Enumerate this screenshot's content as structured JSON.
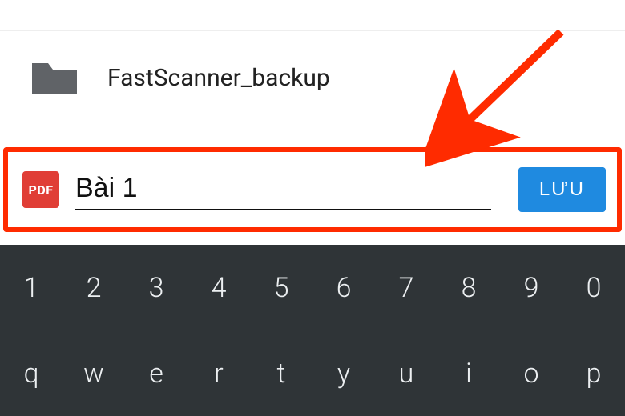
{
  "folder": {
    "name": "FastScanner_backup"
  },
  "file": {
    "type_badge": "PDF",
    "name_value": "Bài 1"
  },
  "actions": {
    "save_label": "LƯU"
  },
  "keyboard": {
    "row1": [
      "1",
      "2",
      "3",
      "4",
      "5",
      "6",
      "7",
      "8",
      "9",
      "0"
    ],
    "row2": [
      "q",
      "w",
      "e",
      "r",
      "t",
      "y",
      "u",
      "i",
      "o",
      "p"
    ]
  },
  "colors": {
    "highlight": "#ff2b00",
    "save_button": "#1f8ae0",
    "pdf_badge": "#e03e36",
    "keyboard_bg": "#2f3437"
  }
}
